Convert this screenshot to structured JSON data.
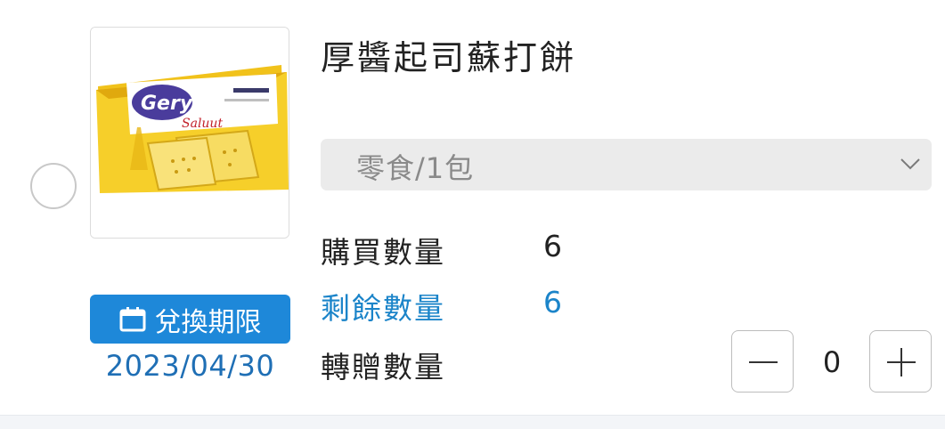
{
  "product": {
    "title": "厚醬起司蘇打餅",
    "variant_select": {
      "value": "零食/1包"
    },
    "image_icon": "cracker-package-image"
  },
  "expiry": {
    "badge_label": "兌換期限",
    "icon": "calendar-icon",
    "date": "2023/04/30"
  },
  "quantities": {
    "purchased_label": "購買數量",
    "purchased_value": "6",
    "remaining_label": "剩餘數量",
    "remaining_value": "6",
    "gift_label": "轉贈數量",
    "gift_value": "0"
  },
  "colors": {
    "accent_blue": "#1e88d9",
    "remaining_text": "#1b84c9",
    "select_bg": "#ebebeb"
  }
}
